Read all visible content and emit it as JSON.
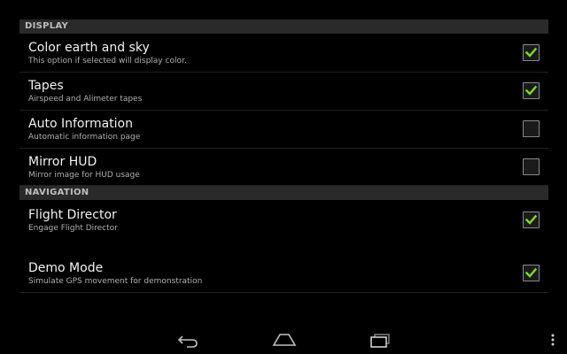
{
  "sections": [
    {
      "header": "DISPLAY",
      "items": [
        {
          "title": "Color earth and sky",
          "summary": "This option if selected will display color.",
          "checked": true
        },
        {
          "title": "Tapes",
          "summary": "Airspeed and Alimeter tapes",
          "checked": true
        },
        {
          "title": "Auto Information",
          "summary": "Automatic information page",
          "checked": false
        },
        {
          "title": "Mirror HUD",
          "summary": "Mirror image for HUD usage",
          "checked": false
        }
      ]
    },
    {
      "header": "NAVIGATION",
      "items": [
        {
          "title": "Flight Director",
          "summary": "Engage Flight Director",
          "checked": true
        },
        {
          "title": "Demo Mode",
          "summary": "Simulate GPS movement for demonstration",
          "checked": true
        }
      ]
    }
  ],
  "colors": {
    "check": "#7fdc1e",
    "background": "#000000",
    "header_bg": "#2a2a2a"
  },
  "nav": {
    "back_icon": "back-icon",
    "home_icon": "home-icon",
    "recents_icon": "recents-icon",
    "menu_icon": "overflow-menu-icon"
  }
}
